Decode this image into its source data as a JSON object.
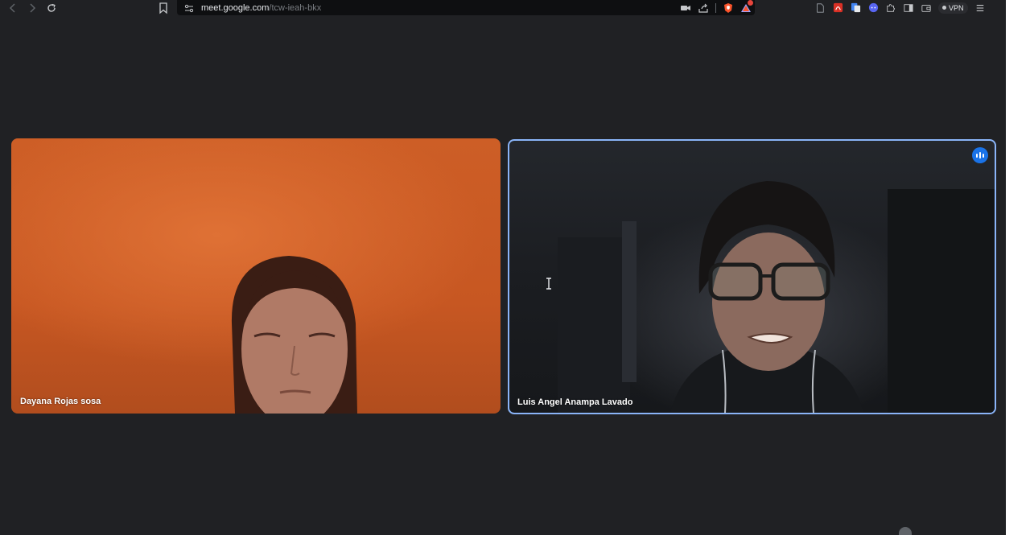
{
  "browser": {
    "url_domain": "meet.google.com",
    "url_path": "/tcw-ieah-bkx",
    "vpn_label": "VPN",
    "icons": [
      "back-icon",
      "forward-icon",
      "reload-icon",
      "bookmark-icon",
      "site-info-icon",
      "camera-icon",
      "share-icon",
      "brave-shield-icon",
      "brave-rewards-icon",
      "pdf-icon",
      "translate-icon",
      "discord-icon",
      "extensions-icon",
      "sidebar-icon",
      "wallet-icon",
      "menu-icon"
    ]
  },
  "meeting": {
    "participants": [
      {
        "name": "Dayana Rojas sosa",
        "speaking": false
      },
      {
        "name": "Luis Angel Anampa Lavado",
        "speaking": true
      }
    ]
  },
  "colors": {
    "background": "#202124",
    "active_speaker_border": "#8ab4f8",
    "speaking_badge": "#1a73e8"
  }
}
